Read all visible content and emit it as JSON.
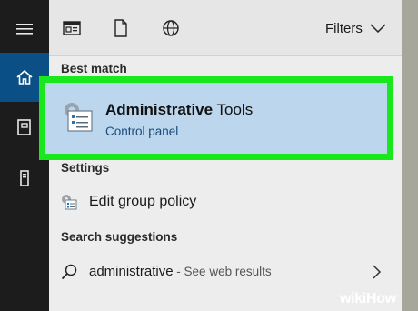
{
  "rail": {
    "icons": [
      "menu-icon",
      "home-icon",
      "documents-icon",
      "tower-icon"
    ],
    "active_color": "#0a4f85"
  },
  "topbar": {
    "icons": [
      "apps-icon",
      "document-icon",
      "globe-icon"
    ],
    "filters_label": "Filters"
  },
  "best_match": {
    "section": "Best match",
    "title_bold": "Administrative",
    "title_rest": " Tools",
    "subtitle": "Control panel",
    "highlight_color": "#19e81c"
  },
  "settings": {
    "section": "Settings",
    "item_label": "Edit group policy"
  },
  "suggestions": {
    "section": "Search suggestions",
    "query": "administrative",
    "suffix": " - See web results"
  },
  "watermark": "wikiHow"
}
